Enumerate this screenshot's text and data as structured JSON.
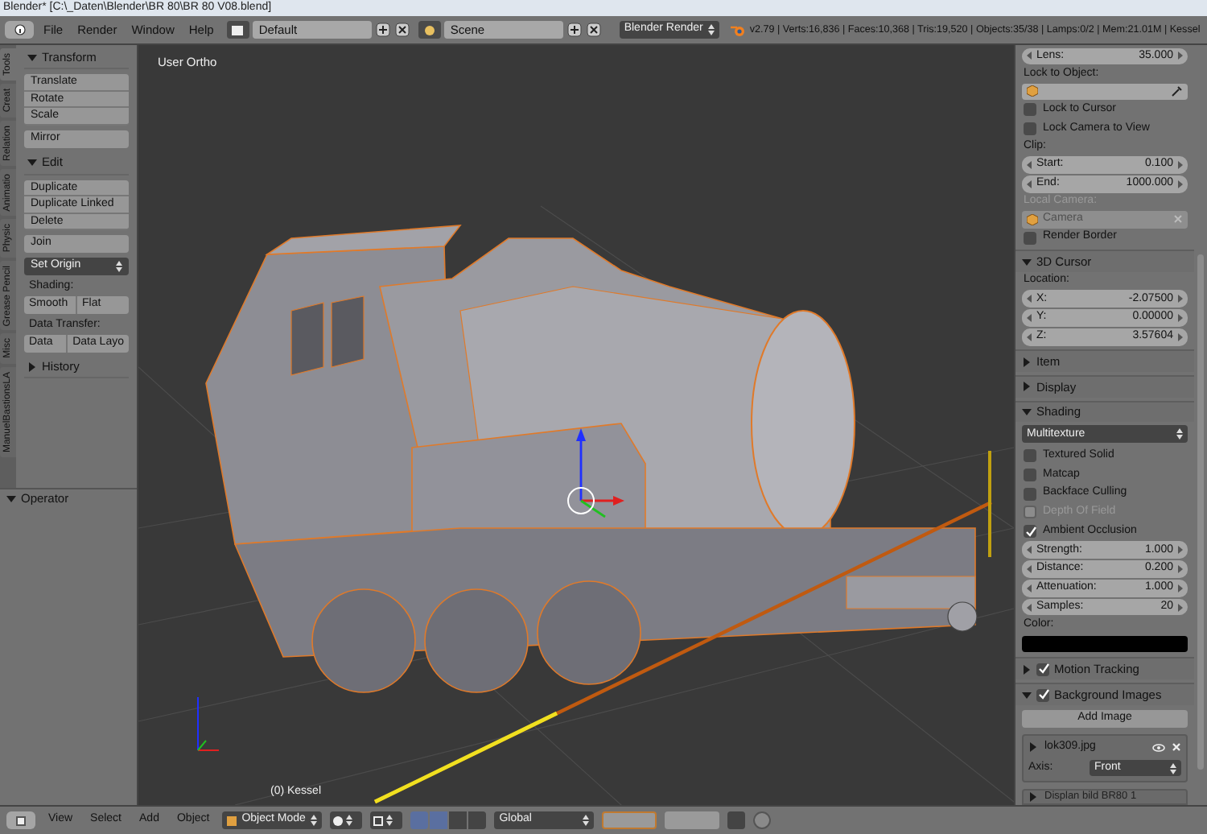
{
  "window": {
    "title": "Blender* [C:\\_Daten\\Blender\\BR 80\\BR 80 V08.blend]"
  },
  "header": {
    "menus": [
      {
        "label": "File"
      },
      {
        "label": "Render"
      },
      {
        "label": "Window"
      },
      {
        "label": "Help"
      }
    ],
    "layout": "Default",
    "scene": "Scene",
    "engine": "Blender Render",
    "stats": "v2.79 | Verts:16,836 | Faces:10,368 | Tris:19,520 | Objects:35/38 | Lamps:0/2 | Mem:21.01M | Kessel"
  },
  "tool_shelf": {
    "tabs": [
      {
        "label": "Tools",
        "selected": true
      },
      {
        "label": "Creat",
        "selected": false
      },
      {
        "label": "Relation",
        "selected": false
      },
      {
        "label": "Animatio",
        "selected": false
      },
      {
        "label": "Physic",
        "selected": false
      },
      {
        "label": "Grease Pencil",
        "selected": false
      },
      {
        "label": "Misc",
        "selected": false
      },
      {
        "label": "ManuelBastionsLA",
        "selected": false
      }
    ],
    "panels": [
      {
        "title": "Transform",
        "expanded": true,
        "items": [
          {
            "kind": "stack",
            "labels": [
              "Translate",
              "Rotate",
              "Scale"
            ]
          },
          {
            "kind": "button",
            "label": "Mirror"
          }
        ]
      },
      {
        "title": "Edit",
        "expanded": true,
        "items": [
          {
            "kind": "stack",
            "labels": [
              "Duplicate",
              "Duplicate Linked",
              "Delete"
            ]
          },
          {
            "kind": "button",
            "label": "Join"
          },
          {
            "kind": "dropdown",
            "label": "Set Origin"
          },
          {
            "kind": "label",
            "label": "Shading:"
          },
          {
            "kind": "row",
            "labels": [
              "Smooth",
              "Flat"
            ]
          },
          {
            "kind": "label",
            "label": "Data Transfer:"
          },
          {
            "kind": "row",
            "labels": [
              "Data",
              "Data Layo"
            ]
          }
        ]
      },
      {
        "title": "History",
        "expanded": false
      }
    ],
    "operator": {
      "title": "Operator",
      "expanded": true
    }
  },
  "viewport": {
    "view_label": "User Ortho",
    "object_label": "(0) Kessel"
  },
  "properties": {
    "rows": [
      {
        "kind": "number",
        "label": "Lens:",
        "value": "35.000",
        "disabled": false
      },
      {
        "kind": "label",
        "text": "Lock to Object:",
        "disabled": false
      },
      {
        "kind": "object_field",
        "value": null,
        "disabled": false
      },
      {
        "kind": "checkbox",
        "label": "Lock to Cursor",
        "checked": false,
        "disabled": false
      },
      {
        "kind": "checkbox",
        "label": "Lock Camera to View",
        "checked": false,
        "disabled": false
      },
      {
        "kind": "label",
        "text": "Clip:",
        "disabled": false
      },
      {
        "kind": "number",
        "label": "Start:",
        "value": "0.100",
        "disabled": false
      },
      {
        "kind": "number",
        "label": "End:",
        "value": "1000.000",
        "disabled": false
      },
      {
        "kind": "label",
        "text": "Local Camera:",
        "disabled": true
      },
      {
        "kind": "object_field",
        "value": "Camera",
        "disabled": true
      },
      {
        "kind": "checkbox",
        "label": "Render Border",
        "checked": false,
        "disabled": false
      },
      {
        "kind": "section",
        "title": "3D Cursor",
        "expanded": true
      },
      {
        "kind": "label",
        "text": "Location:",
        "disabled": false
      },
      {
        "kind": "number",
        "label": "X:",
        "value": "-2.07500",
        "disabled": false
      },
      {
        "kind": "number",
        "label": "Y:",
        "value": "0.00000",
        "disabled": false
      },
      {
        "kind": "number",
        "label": "Z:",
        "value": "3.57604",
        "disabled": false
      },
      {
        "kind": "section",
        "title": "Item",
        "expanded": false
      },
      {
        "kind": "section",
        "title": "Display",
        "expanded": false
      },
      {
        "kind": "section",
        "title": "Shading",
        "expanded": true
      },
      {
        "kind": "dropdown",
        "value": "Multitexture"
      },
      {
        "kind": "checkbox",
        "label": "Textured Solid",
        "checked": false,
        "disabled": false
      },
      {
        "kind": "checkbox",
        "label": "Matcap",
        "checked": false,
        "disabled": false
      },
      {
        "kind": "checkbox",
        "label": "Backface Culling",
        "checked": false,
        "disabled": false
      },
      {
        "kind": "checkbox",
        "label": "Depth Of Field",
        "checked": false,
        "disabled": true
      },
      {
        "kind": "checkbox",
        "label": "Ambient Occlusion",
        "checked": true,
        "disabled": false
      },
      {
        "kind": "number",
        "label": "Strength:",
        "value": "1.000",
        "disabled": false
      },
      {
        "kind": "number",
        "label": "Distance:",
        "value": "0.200",
        "disabled": false
      },
      {
        "kind": "number",
        "label": "Attenuation:",
        "value": "1.000",
        "disabled": false
      },
      {
        "kind": "number",
        "label": "Samples:",
        "value": "20",
        "disabled": false
      },
      {
        "kind": "label",
        "text": "Color:",
        "disabled": false
      },
      {
        "kind": "color",
        "color": "#000000"
      },
      {
        "kind": "section",
        "title": "Motion Tracking",
        "expanded": false,
        "checked": true
      },
      {
        "kind": "section",
        "title": "Background Images",
        "expanded": true,
        "checked": true
      },
      {
        "kind": "button",
        "label": "Add Image"
      },
      {
        "kind": "image",
        "name": "lok309.jpg",
        "axis_label": "Axis:",
        "axis_value": "Front"
      },
      {
        "kind": "image_cut",
        "name": "Displan bild BR80 1"
      }
    ]
  },
  "bottom_bar": {
    "menus": [
      {
        "label": "View"
      },
      {
        "label": "Select"
      },
      {
        "label": "Add"
      },
      {
        "label": "Object"
      }
    ],
    "mode": "Object Mode",
    "orientation": "Global"
  }
}
